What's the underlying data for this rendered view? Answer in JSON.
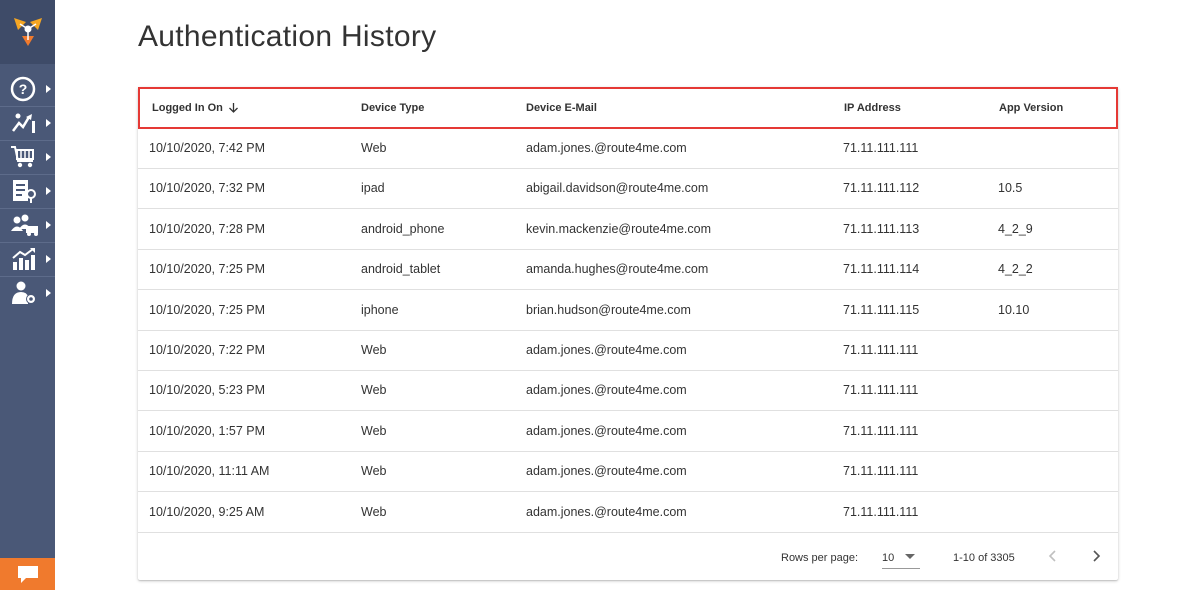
{
  "page": {
    "title": "Authentication History"
  },
  "sidebar": {
    "items": [
      {
        "icon": "help-icon"
      },
      {
        "icon": "routes-icon"
      },
      {
        "icon": "cart-icon"
      },
      {
        "icon": "orders-icon"
      },
      {
        "icon": "team-icon"
      },
      {
        "icon": "analytics-icon"
      },
      {
        "icon": "user-settings-icon"
      }
    ],
    "colors": {
      "bg": "#4a5877",
      "chat": "#f07a2d"
    }
  },
  "table": {
    "columns": {
      "logged_in_on": "Logged In On",
      "device_type": "Device Type",
      "device_email": "Device E-Mail",
      "ip_address": "IP Address",
      "app_version": "App Version"
    },
    "rows": [
      {
        "logged_in_on": "10/10/2020, 7:42 PM",
        "device_type": "Web",
        "device_email": "adam.jones.@route4me.com",
        "ip_address": "71.11.111.111",
        "app_version": ""
      },
      {
        "logged_in_on": "10/10/2020, 7:32 PM",
        "device_type": "ipad",
        "device_email": "abigail.davidson@route4me.com",
        "ip_address": "71.11.111.112",
        "app_version": "10.5"
      },
      {
        "logged_in_on": "10/10/2020, 7:28 PM",
        "device_type": "android_phone",
        "device_email": "kevin.mackenzie@route4me.com",
        "ip_address": "71.11.111.113",
        "app_version": "4_2_9"
      },
      {
        "logged_in_on": "10/10/2020, 7:25 PM",
        "device_type": "android_tablet",
        "device_email": "amanda.hughes@route4me.com",
        "ip_address": "71.11.111.114",
        "app_version": "4_2_2"
      },
      {
        "logged_in_on": "10/10/2020, 7:25 PM",
        "device_type": "iphone",
        "device_email": "brian.hudson@route4me.com",
        "ip_address": "71.11.111.115",
        "app_version": "10.10"
      },
      {
        "logged_in_on": "10/10/2020, 7:22 PM",
        "device_type": "Web",
        "device_email": "adam.jones.@route4me.com",
        "ip_address": "71.11.111.111",
        "app_version": ""
      },
      {
        "logged_in_on": "10/10/2020, 5:23 PM",
        "device_type": "Web",
        "device_email": "adam.jones.@route4me.com",
        "ip_address": "71.11.111.111",
        "app_version": ""
      },
      {
        "logged_in_on": "10/10/2020, 1:57 PM",
        "device_type": "Web",
        "device_email": "adam.jones.@route4me.com",
        "ip_address": "71.11.111.111",
        "app_version": ""
      },
      {
        "logged_in_on": "10/10/2020, 11:11 AM",
        "device_type": "Web",
        "device_email": "adam.jones.@route4me.com",
        "ip_address": "71.11.111.111",
        "app_version": ""
      },
      {
        "logged_in_on": "10/10/2020, 9:25 AM",
        "device_type": "Web",
        "device_email": "adam.jones.@route4me.com",
        "ip_address": "71.11.111.111",
        "app_version": ""
      }
    ]
  },
  "pagination": {
    "rows_per_page_label": "Rows per page:",
    "rows_per_page_value": "10",
    "range": "1-10 of 3305"
  },
  "colors": {
    "highlight_border": "#e53935"
  }
}
